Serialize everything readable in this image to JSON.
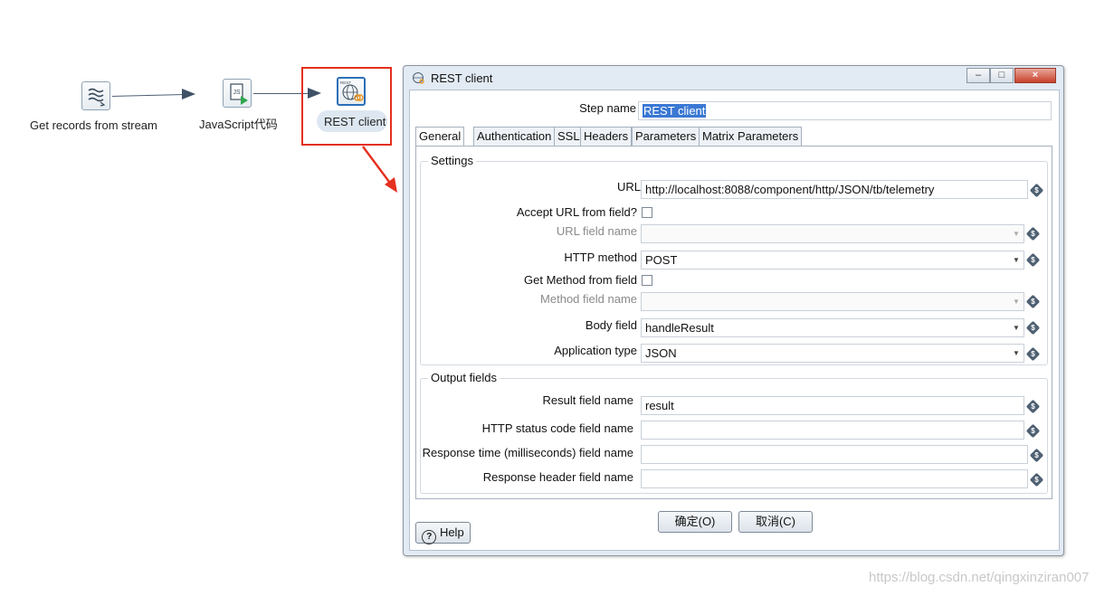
{
  "canvas": {
    "steps": [
      {
        "label": "Get records from stream",
        "icon": "stream-icon"
      },
      {
        "label": "JavaScript代码",
        "icon": "javascript-icon"
      },
      {
        "label": "REST client",
        "icon": "rest-icon",
        "selected": true
      }
    ],
    "highlight_color": "#e52f1f"
  },
  "dialog": {
    "title": "REST client",
    "window_buttons": {
      "minimize": "–",
      "maximize": "□",
      "close": "×"
    },
    "step_name_label": "Step name",
    "step_name_value": "REST client",
    "tabs": [
      "General",
      "Authentication",
      "SSL",
      "Headers",
      "Parameters",
      "Matrix Parameters"
    ],
    "active_tab": "General",
    "settings": {
      "title": "Settings",
      "url_label": "URL",
      "url_value": "http://localhost:8088/component/http/JSON/tb/telemetry",
      "accept_url_label": "Accept URL from field?",
      "url_field_label": "URL field name",
      "url_field_value": "",
      "http_method_label": "HTTP method",
      "http_method_value": "POST",
      "get_method_label": "Get Method from field",
      "method_field_label": "Method field name",
      "method_field_value": "",
      "body_field_label": "Body field",
      "body_field_value": "handleResult",
      "app_type_label": "Application type",
      "app_type_value": "JSON"
    },
    "output": {
      "title": "Output fields",
      "result_label": "Result field name",
      "result_value": "result",
      "status_label": "HTTP status code field name",
      "status_value": "",
      "response_time_label": "Response time (milliseconds) field name",
      "response_time_value": "",
      "response_header_label": "Response header field name",
      "response_header_value": ""
    },
    "buttons": {
      "ok": "确定(O)",
      "cancel": "取消(C)",
      "help": "Help"
    }
  },
  "watermark": "https://blog.csdn.net/qingxinziran007"
}
